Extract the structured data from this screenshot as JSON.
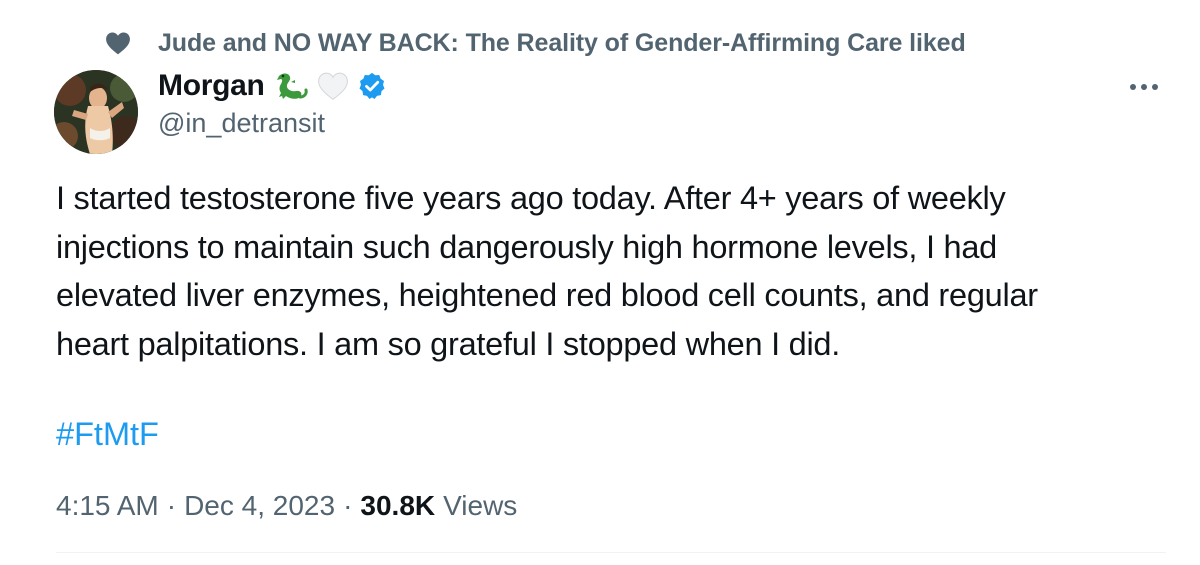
{
  "social_context": {
    "icon": "heart-icon",
    "text": "Jude and NO WAY BACK: The Reality of Gender-Affirming Care liked"
  },
  "author": {
    "display_name": "Morgan",
    "name_emojis": [
      "lizard-emoji",
      "white-heart-emoji"
    ],
    "verified": true,
    "handle": "@in_detransit"
  },
  "tweet": {
    "text": "I started testosterone five years ago today. After 4+ years of weekly\ninjections to maintain such dangerously high hormone levels, I had\nelevated liver enzymes, heightened red blood cell counts, and regular\nheart palpitations. I am so grateful I stopped when I did.",
    "hashtag": "#FtMtF"
  },
  "meta": {
    "time": "4:15 AM",
    "separator": "·",
    "date": "Dec 4, 2023",
    "views_count": "30.8K",
    "views_label": "Views"
  },
  "colors": {
    "text_primary": "#0f1419",
    "text_secondary": "#536471",
    "accent": "#1d9bf0",
    "divider": "#eff3f4"
  }
}
